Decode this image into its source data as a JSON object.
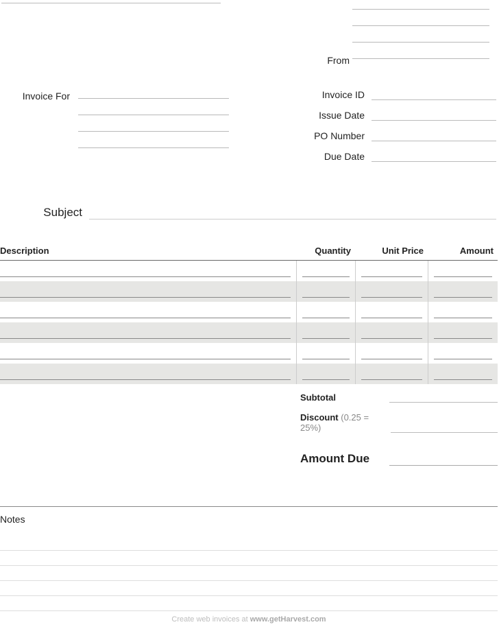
{
  "header": {
    "from_label": "From",
    "invoice_for_label": "Invoice For",
    "subject_label": "Subject"
  },
  "meta": {
    "rows": [
      {
        "label": "Invoice ID"
      },
      {
        "label": "Issue Date"
      },
      {
        "label": "PO Number"
      },
      {
        "label": "Due Date"
      }
    ]
  },
  "items": {
    "headers": {
      "description": "Description",
      "quantity": "Quantity",
      "unit_price": "Unit Price",
      "amount": "Amount"
    },
    "row_count": 6
  },
  "totals": {
    "subtotal_label": "Subtotal",
    "discount_label": "Discount",
    "discount_hint": "(0.25 = 25%)",
    "amount_due_label": "Amount Due"
  },
  "notes": {
    "label": "Notes",
    "line_count": 5
  },
  "footer": {
    "prefix": "Create web invoices at ",
    "site": "www.getHarvest.com"
  }
}
